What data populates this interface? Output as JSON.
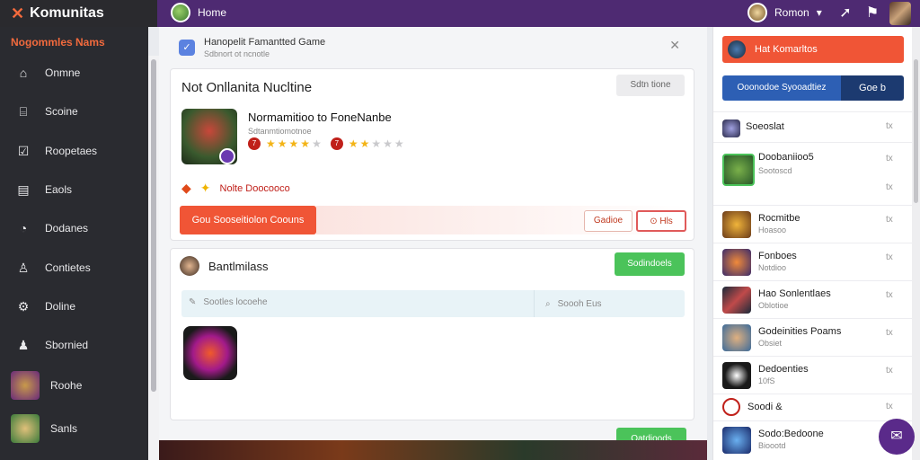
{
  "app": {
    "brand_mark": "✕",
    "brand_name": "Komunitas"
  },
  "topbar": {
    "home_label": "Home",
    "user_label": "Romon"
  },
  "sidebar": {
    "title": "Nogommles Nams",
    "items": [
      {
        "label": "Onmne",
        "icon": "home-icon"
      },
      {
        "label": "Scoine",
        "icon": "store-icon"
      },
      {
        "label": "Roopetaes",
        "icon": "check-icon"
      },
      {
        "label": "Eaols",
        "icon": "grid-icon"
      },
      {
        "label": "Dodanes",
        "icon": "chat-icon"
      },
      {
        "label": "Contietes",
        "icon": "person-icon"
      },
      {
        "label": "Doline",
        "icon": "gear-icon"
      },
      {
        "label": "Sbornied",
        "icon": "user-settings-icon"
      },
      {
        "label": "Roohe",
        "icon": "game-thumb"
      },
      {
        "label": "Sanls",
        "icon": "game-thumb"
      }
    ]
  },
  "notification": {
    "title": "Hanopelit Famantted Game",
    "subtitle": "Sdbnort ot ncnotle"
  },
  "game_card": {
    "title": "Not Onllanita Nucltine",
    "top_button": "Sdtn tione",
    "game_name": "Normamitioo to FoneNanbe",
    "game_sub": "Sdtanmtiomotnoe",
    "rating_a_label": "7",
    "rating_b_label": "7",
    "warning_text": "Nolte Doocooco",
    "cta_label": "Gou Sooseitiolon Coouns",
    "outline_btn_1": "Gadioe",
    "outline_btn_2": "Hls"
  },
  "community_card": {
    "title": "Bantlmilass",
    "top_button": "Sodindoels",
    "search_placeholder": "Sootles locoehe",
    "search_right": "Soooh Eus",
    "bottom_button": "Oatdioods"
  },
  "right_panel": {
    "notif_label": "Hat Komarltos",
    "split_left": "Ooonodoe Syooadtiez",
    "split_right": "Goe b",
    "items": [
      {
        "name": "Soeoslat",
        "sub": "",
        "close": "tx"
      },
      {
        "name": "Doobaniioo5",
        "sub": "Sootoscd",
        "close": "tx"
      },
      {
        "name": "Rocmitbe",
        "sub": "Hoasoo",
        "close": "tx"
      },
      {
        "name": "Fonboes",
        "sub": "Notdioo",
        "close": "tx"
      },
      {
        "name": "Hao Sonlentlaes",
        "sub": "Oblotioe",
        "close": "tx"
      },
      {
        "name": "Godeinities Poams",
        "sub": "Obsiet",
        "close": "tx"
      },
      {
        "name": "Dedoenties",
        "sub": "10fS",
        "close": "tx"
      },
      {
        "name": "Soodi &",
        "sub": "",
        "close": "tx"
      },
      {
        "name": "Sodo:Bedoone",
        "sub": "Bioootd",
        "close": "tx"
      }
    ]
  },
  "colors": {
    "topbar": "#4e2a72",
    "sidebar": "#2a2b30",
    "accent": "#f05536",
    "green": "#4bc35a",
    "blue": "#2d5fb4"
  }
}
